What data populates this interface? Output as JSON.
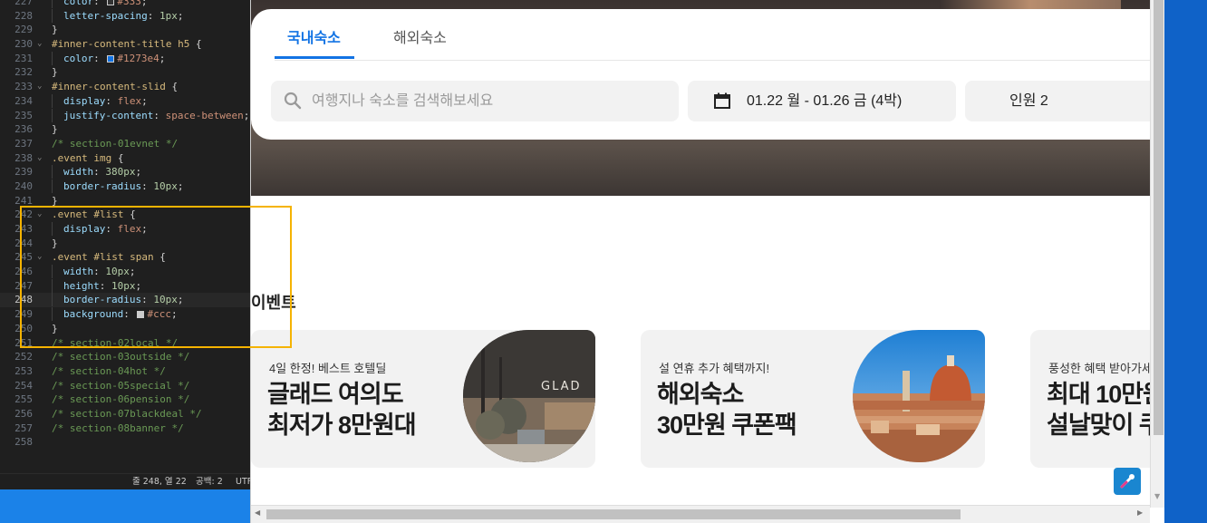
{
  "editor": {
    "lines": [
      {
        "n": "227",
        "fold": "",
        "parts": [
          {
            "c": "i"
          },
          {
            "c": "prop",
            "t": "color"
          },
          {
            "c": "pun",
            "t": ": "
          },
          {
            "c": "sw",
            "color": "#333333"
          },
          {
            "c": "val",
            "t": "#333"
          },
          {
            "c": "pun",
            "t": ";"
          }
        ]
      },
      {
        "n": "228",
        "fold": "",
        "parts": [
          {
            "c": "i"
          },
          {
            "c": "prop",
            "t": "letter-spacing"
          },
          {
            "c": "pun",
            "t": ": "
          },
          {
            "c": "num",
            "t": "1px"
          },
          {
            "c": "pun",
            "t": ";"
          }
        ]
      },
      {
        "n": "229",
        "fold": "",
        "parts": [
          {
            "c": "pun",
            "t": "}"
          }
        ]
      },
      {
        "n": "230",
        "fold": "v",
        "parts": [
          {
            "c": "sel",
            "t": "#inner-content-title h5"
          },
          {
            "c": "pun",
            "t": " {"
          }
        ]
      },
      {
        "n": "231",
        "fold": "",
        "parts": [
          {
            "c": "i"
          },
          {
            "c": "prop",
            "t": "color"
          },
          {
            "c": "pun",
            "t": ": "
          },
          {
            "c": "sw",
            "color": "#1273e4"
          },
          {
            "c": "val",
            "t": "#1273e4"
          },
          {
            "c": "pun",
            "t": ";"
          }
        ]
      },
      {
        "n": "232",
        "fold": "",
        "parts": [
          {
            "c": "pun",
            "t": "}"
          }
        ]
      },
      {
        "n": "233",
        "fold": "v",
        "parts": [
          {
            "c": "sel",
            "t": "#inner-content-slid"
          },
          {
            "c": "pun",
            "t": " {"
          }
        ]
      },
      {
        "n": "234",
        "fold": "",
        "parts": [
          {
            "c": "i"
          },
          {
            "c": "prop",
            "t": "display"
          },
          {
            "c": "pun",
            "t": ": "
          },
          {
            "c": "val",
            "t": "flex"
          },
          {
            "c": "pun",
            "t": ";"
          }
        ]
      },
      {
        "n": "235",
        "fold": "",
        "parts": [
          {
            "c": "i"
          },
          {
            "c": "prop",
            "t": "justify-content"
          },
          {
            "c": "pun",
            "t": ": "
          },
          {
            "c": "val",
            "t": "space-between"
          },
          {
            "c": "pun",
            "t": ";"
          }
        ]
      },
      {
        "n": "236",
        "fold": "",
        "parts": [
          {
            "c": "pun",
            "t": "}"
          }
        ]
      },
      {
        "n": "237",
        "fold": "",
        "parts": [
          {
            "c": "com",
            "t": "/* section-01evnet */"
          }
        ]
      },
      {
        "n": "238",
        "fold": "v",
        "parts": [
          {
            "c": "sel",
            "t": ".event img"
          },
          {
            "c": "pun",
            "t": " {"
          }
        ]
      },
      {
        "n": "239",
        "fold": "",
        "parts": [
          {
            "c": "i"
          },
          {
            "c": "prop",
            "t": "width"
          },
          {
            "c": "pun",
            "t": ": "
          },
          {
            "c": "num",
            "t": "380px"
          },
          {
            "c": "pun",
            "t": ";"
          }
        ]
      },
      {
        "n": "240",
        "fold": "",
        "parts": [
          {
            "c": "i"
          },
          {
            "c": "prop",
            "t": "border-radius"
          },
          {
            "c": "pun",
            "t": ": "
          },
          {
            "c": "num",
            "t": "10px"
          },
          {
            "c": "pun",
            "t": ";"
          }
        ]
      },
      {
        "n": "241",
        "fold": "",
        "parts": [
          {
            "c": "pun",
            "t": "}"
          }
        ]
      },
      {
        "n": "242",
        "fold": "v",
        "parts": [
          {
            "c": "sel",
            "t": ".evnet #list"
          },
          {
            "c": "pun",
            "t": " {"
          }
        ]
      },
      {
        "n": "243",
        "fold": "",
        "parts": [
          {
            "c": "i"
          },
          {
            "c": "prop",
            "t": "display"
          },
          {
            "c": "pun",
            "t": ": "
          },
          {
            "c": "val",
            "t": "flex"
          },
          {
            "c": "pun",
            "t": ";"
          }
        ]
      },
      {
        "n": "244",
        "fold": "",
        "parts": [
          {
            "c": "pun",
            "t": "}"
          }
        ]
      },
      {
        "n": "245",
        "fold": "v",
        "parts": [
          {
            "c": "sel",
            "t": ".event #list span"
          },
          {
            "c": "pun",
            "t": " {"
          }
        ]
      },
      {
        "n": "246",
        "fold": "",
        "parts": [
          {
            "c": "i"
          },
          {
            "c": "prop",
            "t": "width"
          },
          {
            "c": "pun",
            "t": ": "
          },
          {
            "c": "num",
            "t": "10px"
          },
          {
            "c": "pun",
            "t": ";"
          }
        ]
      },
      {
        "n": "247",
        "fold": "",
        "parts": [
          {
            "c": "i"
          },
          {
            "c": "prop",
            "t": "height"
          },
          {
            "c": "pun",
            "t": ": "
          },
          {
            "c": "num",
            "t": "10px"
          },
          {
            "c": "pun",
            "t": ";"
          }
        ]
      },
      {
        "n": "248",
        "fold": "",
        "cur": true,
        "parts": [
          {
            "c": "i"
          },
          {
            "c": "prop",
            "t": "border-radius"
          },
          {
            "c": "pun",
            "t": ": "
          },
          {
            "c": "num",
            "t": "10px"
          },
          {
            "c": "pun",
            "t": ";"
          }
        ]
      },
      {
        "n": "249",
        "fold": "",
        "parts": [
          {
            "c": "i"
          },
          {
            "c": "prop",
            "t": "background"
          },
          {
            "c": "pun",
            "t": ": "
          },
          {
            "c": "sw",
            "color": "#cccccc"
          },
          {
            "c": "val",
            "t": "#ccc"
          },
          {
            "c": "pun",
            "t": ";"
          }
        ]
      },
      {
        "n": "250",
        "fold": "",
        "parts": [
          {
            "c": "pun",
            "t": "}"
          }
        ]
      },
      {
        "n": "251",
        "fold": "",
        "parts": [
          {
            "c": "com",
            "t": "/* section-02local */"
          }
        ]
      },
      {
        "n": "252",
        "fold": "",
        "parts": [
          {
            "c": "com",
            "t": "/* section-03outside */"
          }
        ]
      },
      {
        "n": "253",
        "fold": "",
        "parts": [
          {
            "c": "com",
            "t": "/* section-04hot */"
          }
        ]
      },
      {
        "n": "254",
        "fold": "",
        "parts": [
          {
            "c": "com",
            "t": "/* section-05special */"
          }
        ]
      },
      {
        "n": "255",
        "fold": "",
        "parts": [
          {
            "c": "com",
            "t": "/* section-06pension */"
          }
        ]
      },
      {
        "n": "256",
        "fold": "",
        "parts": [
          {
            "c": "com",
            "t": "/* section-07blackdeal */"
          }
        ]
      },
      {
        "n": "257",
        "fold": "",
        "parts": [
          {
            "c": "com",
            "t": "/* section-08banner */"
          }
        ]
      },
      {
        "n": "258",
        "fold": "",
        "parts": []
      }
    ],
    "status": {
      "position": "줄 248, 열 22",
      "spaces": "공백: 2",
      "encoding": "UTF"
    }
  },
  "page": {
    "tabs": [
      "국내숙소",
      "해외숙소"
    ],
    "search_placeholder": "여행지나 숙소를 검색해보세요",
    "date_range": "01.22 월 - 01.26 금 (4박)",
    "guests": "인원 2",
    "accent_color": "#1273e4",
    "event_section_title": "이벤트",
    "events": [
      {
        "subtitle": "4일 한정! 베스트 호텔딜",
        "title_line1": "글래드 여의도",
        "title_line2": "최저가 8만원대",
        "image_text": "GLAD"
      },
      {
        "subtitle": "설 연휴 추가 혜택까지!",
        "title_line1": "해외숙소",
        "title_line2": "30만원 쿠폰팩"
      },
      {
        "subtitle": "풍성한 혜택 받아가세",
        "title_line1": "최대 10만원",
        "title_line2": "설날맞이 쿠"
      }
    ]
  }
}
